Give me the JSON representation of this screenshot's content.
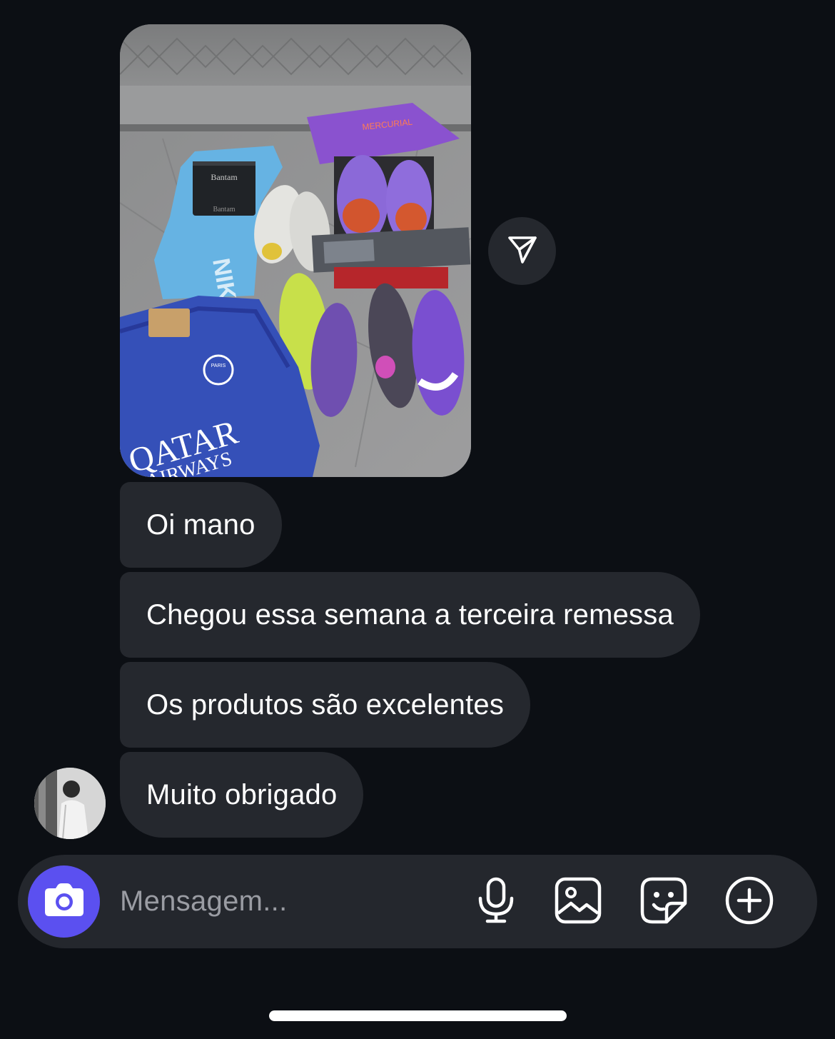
{
  "thread": {
    "photo_alt": "Foto de camisas e chuteiras sobre um sofá",
    "photo_texts": {
      "box_brand": "Bantam",
      "jersey_sponsor_line1": "QATAR",
      "jersey_sponsor_line2": "AIRWAYS",
      "jersey_crest": "PARIS"
    },
    "messages": [
      {
        "text": "Oi mano"
      },
      {
        "text": "Chegou essa semana a terceira remessa"
      },
      {
        "text": "Os produtos são excelentes"
      },
      {
        "text": "Muito obrigado"
      }
    ]
  },
  "composer": {
    "placeholder": "Mensagem..."
  },
  "icons": {
    "share": "send-icon",
    "camera": "camera-icon",
    "mic": "microphone-icon",
    "gallery": "image-icon",
    "sticker": "sticker-icon",
    "more": "plus-circle-icon"
  },
  "colors": {
    "background": "#0c0f14",
    "bubble": "#24272d",
    "camera_button": "#5b50f0",
    "placeholder": "#9a9ca3"
  }
}
